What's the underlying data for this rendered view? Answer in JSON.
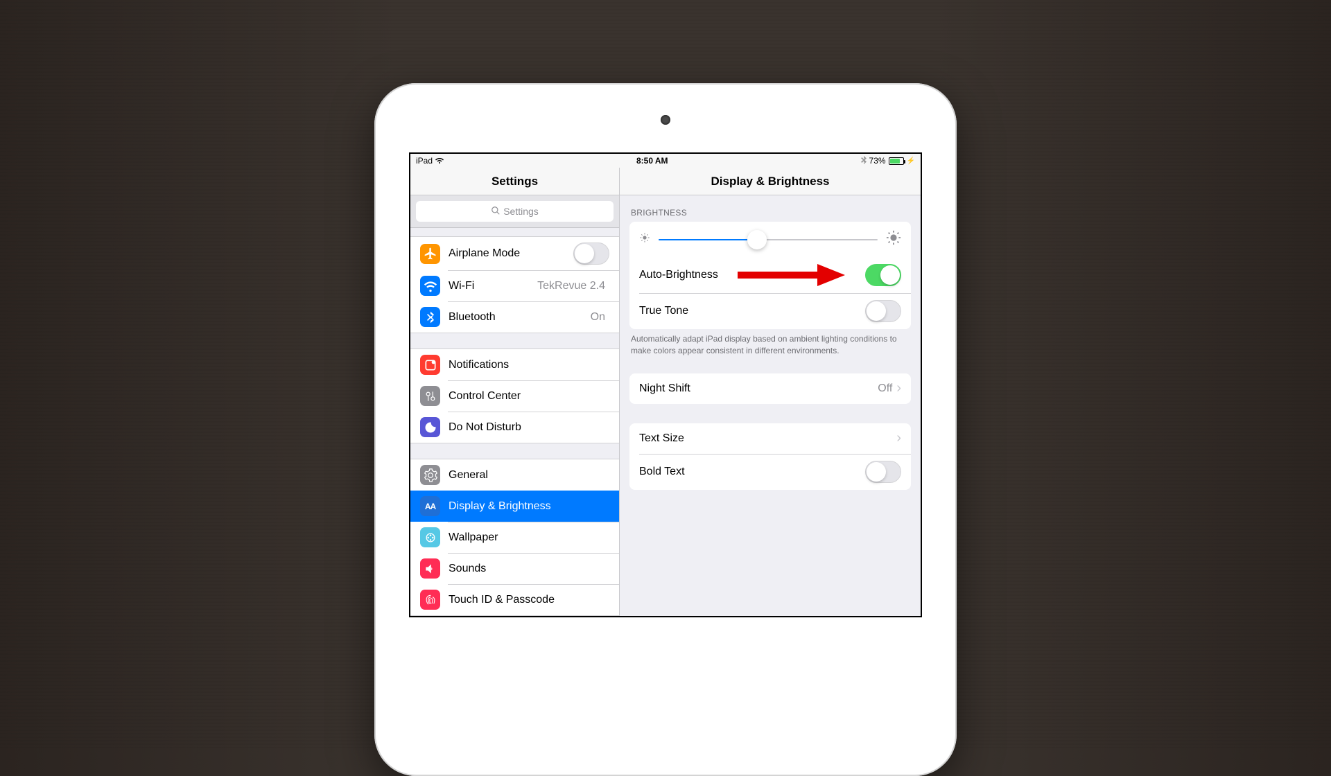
{
  "status": {
    "device": "iPad",
    "time": "8:50 AM",
    "battery_pct": "73%"
  },
  "sidebar": {
    "title": "Settings",
    "search_placeholder": "Settings",
    "groups": [
      [
        {
          "label": "Airplane Mode",
          "toggle": false,
          "icon": "airplane",
          "color": "#ff9500"
        },
        {
          "label": "Wi-Fi",
          "value": "TekRevue 2.4",
          "icon": "wifi",
          "color": "#007aff"
        },
        {
          "label": "Bluetooth",
          "value": "On",
          "icon": "bluetooth",
          "color": "#007aff"
        }
      ],
      [
        {
          "label": "Notifications",
          "icon": "notifications",
          "color": "#ff3b30"
        },
        {
          "label": "Control Center",
          "icon": "control",
          "color": "#8e8e93"
        },
        {
          "label": "Do Not Disturb",
          "icon": "moon",
          "color": "#5856d6"
        }
      ],
      [
        {
          "label": "General",
          "icon": "gear",
          "color": "#8e8e93"
        },
        {
          "label": "Display & Brightness",
          "icon": "aa",
          "color": "#007aff",
          "selected": true
        },
        {
          "label": "Wallpaper",
          "icon": "wallpaper",
          "color": "#56c8e5"
        },
        {
          "label": "Sounds",
          "icon": "sound",
          "color": "#ff2d55"
        },
        {
          "label": "Touch ID & Passcode",
          "icon": "touchid",
          "color": "#ff2d55"
        }
      ]
    ]
  },
  "detail": {
    "title": "Display & Brightness",
    "brightness_header": "BRIGHTNESS",
    "brightness_pct": 45,
    "auto_brightness_label": "Auto-Brightness",
    "auto_brightness_on": true,
    "true_tone_label": "True Tone",
    "true_tone_on": false,
    "true_tone_footer": "Automatically adapt iPad display based on ambient lighting conditions to make colors appear consistent in different environments.",
    "night_shift_label": "Night Shift",
    "night_shift_value": "Off",
    "text_size_label": "Text Size",
    "bold_text_label": "Bold Text",
    "bold_text_on": false
  },
  "annotation": {
    "arrow_points_to": "true-tone-toggle"
  }
}
